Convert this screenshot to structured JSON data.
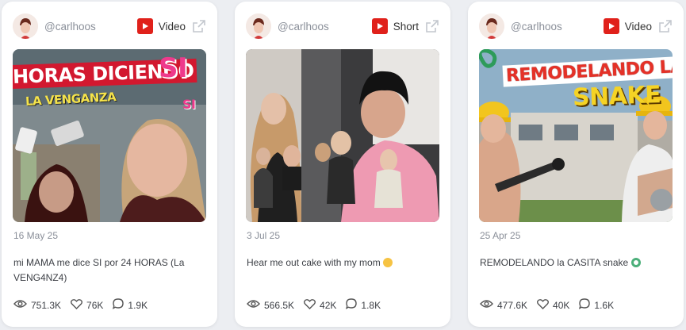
{
  "cards": [
    {
      "handle": "@carlhoos",
      "type": "Video",
      "thumbnail": {
        "line1": "HORAS DICIENDO",
        "line2": "LA VENGANZA",
        "accent": "SI",
        "accent2": "SI"
      },
      "date": "16 May 25",
      "caption": "mi MAMA me dice SI por 24 HORAS (La VENG4NZ4)",
      "views": "751.3K",
      "likes": "76K",
      "comments": "1.9K"
    },
    {
      "handle": "@carlhoos",
      "type": "Short",
      "thumbnail": {},
      "date": "3 Jul 25",
      "caption": "Hear me out cake with my mom",
      "views": "566.5K",
      "likes": "42K",
      "comments": "1.8K"
    },
    {
      "handle": "@carlhoos",
      "type": "Video",
      "thumbnail": {
        "line1": "REMODELANDO LA C",
        "line2": "SNAKE"
      },
      "date": "25 Apr 25",
      "caption": "REMODELANDO la CASITA snake",
      "views": "477.6K",
      "likes": "40K",
      "comments": "1.6K"
    }
  ],
  "colors": {
    "youtube_red": "#e0211b",
    "background": "#eceef2",
    "card": "#ffffff"
  },
  "icons": [
    "avatar",
    "youtube-icon",
    "external-link-icon",
    "eye-icon",
    "heart-icon",
    "comment-icon"
  ]
}
